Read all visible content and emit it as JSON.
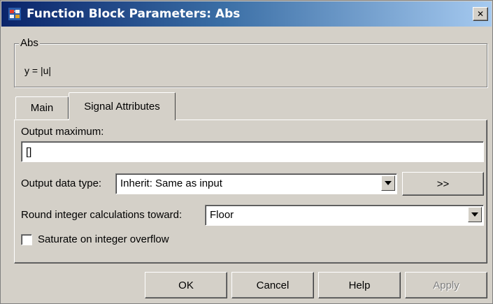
{
  "window": {
    "title": "Function Block Parameters: Abs",
    "close_label": "✕"
  },
  "description": {
    "block_name": "Abs",
    "formula": "y = |u|"
  },
  "tabs": [
    {
      "label": "Main",
      "active": false
    },
    {
      "label": "Signal Attributes",
      "active": true
    }
  ],
  "signal_attributes": {
    "output_maximum_label": "Output maximum:",
    "output_maximum_value": "[]",
    "output_data_type_label": "Output data type:",
    "output_data_type_value": "Inherit: Same as input",
    "data_type_assistant_label": ">>",
    "round_label": "Round integer calculations toward:",
    "round_value": "Floor",
    "saturate_label": "Saturate on integer overflow",
    "saturate_checked": false
  },
  "buttons": {
    "ok": "OK",
    "cancel": "Cancel",
    "help": "Help",
    "apply": "Apply"
  },
  "icons": {
    "app": "simulink-block-icon",
    "close": "close-icon",
    "dropdown": "chevron-down-icon"
  }
}
